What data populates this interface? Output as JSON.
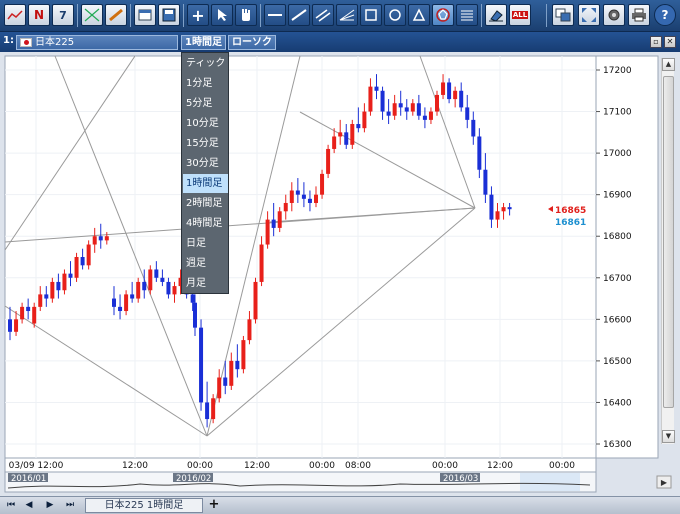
{
  "app": {
    "accent": "#1f4a85"
  },
  "toolbar": {
    "news_letter": "N",
    "calendar_day": "7",
    "all_label": "ALL"
  },
  "symbol": {
    "index": "1:",
    "name": "日本225",
    "timeframe": "1時間足",
    "chart_style": "ローソク"
  },
  "dropdown": {
    "items": [
      "ティック",
      "1分足",
      "5分足",
      "10分足",
      "15分足",
      "30分足",
      "1時間足",
      "2時間足",
      "4時間足",
      "日足",
      "週足",
      "月足"
    ],
    "selected": "1時間足"
  },
  "price_axis": {
    "ticks": [
      "17200",
      "17100",
      "17000",
      "16900",
      "16800",
      "16700",
      "16600",
      "16500",
      "16400",
      "16300"
    ],
    "ask_label": "16865",
    "bid_label": "16861",
    "ask_color": "#e0201c",
    "bid_color": "#1e90d0"
  },
  "time_axis": {
    "labels": [
      "03/09 12:00",
      "12:00",
      "00:00",
      "12:00",
      "00:00",
      "08:00",
      "00:00",
      "12:00",
      "00:00"
    ]
  },
  "navigator": {
    "labels": [
      "2016/01",
      "2016/02",
      "2016/03"
    ]
  },
  "bottom": {
    "tab_label": "日本225 1時間足",
    "add_label": "+"
  },
  "chart_data": {
    "type": "candlestick",
    "ylim": [
      16280,
      17240
    ],
    "up_color": "#e8201a",
    "down_color": "#1a2fd6",
    "candles": [
      {
        "o": 16600,
        "h": 16630,
        "l": 16550,
        "c": 16570
      },
      {
        "o": 16570,
        "h": 16620,
        "l": 16560,
        "c": 16600
      },
      {
        "o": 16600,
        "h": 16640,
        "l": 16590,
        "c": 16630
      },
      {
        "o": 16630,
        "h": 16650,
        "l": 16600,
        "c": 16620
      },
      {
        "o": 16590,
        "h": 16640,
        "l": 16580,
        "c": 16630
      },
      {
        "o": 16630,
        "h": 16680,
        "l": 16620,
        "c": 16660
      },
      {
        "o": 16660,
        "h": 16680,
        "l": 16630,
        "c": 16650
      },
      {
        "o": 16650,
        "h": 16700,
        "l": 16640,
        "c": 16690
      },
      {
        "o": 16690,
        "h": 16710,
        "l": 16650,
        "c": 16670
      },
      {
        "o": 16670,
        "h": 16720,
        "l": 16660,
        "c": 16710
      },
      {
        "o": 16710,
        "h": 16740,
        "l": 16680,
        "c": 16700
      },
      {
        "o": 16700,
        "h": 16760,
        "l": 16690,
        "c": 16750
      },
      {
        "o": 16750,
        "h": 16770,
        "l": 16720,
        "c": 16730
      },
      {
        "o": 16730,
        "h": 16790,
        "l": 16720,
        "c": 16780
      },
      {
        "o": 16780,
        "h": 16820,
        "l": 16760,
        "c": 16800
      },
      {
        "o": 16800,
        "h": 16830,
        "l": 16770,
        "c": 16790
      },
      {
        "o": 16790,
        "h": 16810,
        "l": 16780,
        "c": 16800
      },
      {
        "o": 16650,
        "h": 16680,
        "l": 16610,
        "c": 16630
      },
      {
        "o": 16630,
        "h": 16660,
        "l": 16600,
        "c": 16620
      },
      {
        "o": 16620,
        "h": 16670,
        "l": 16610,
        "c": 16660
      },
      {
        "o": 16660,
        "h": 16690,
        "l": 16640,
        "c": 16650
      },
      {
        "o": 16650,
        "h": 16700,
        "l": 16640,
        "c": 16690
      },
      {
        "o": 16690,
        "h": 16720,
        "l": 16650,
        "c": 16670
      },
      {
        "o": 16670,
        "h": 16730,
        "l": 16660,
        "c": 16720
      },
      {
        "o": 16720,
        "h": 16740,
        "l": 16690,
        "c": 16700
      },
      {
        "o": 16700,
        "h": 16720,
        "l": 16680,
        "c": 16690
      },
      {
        "o": 16690,
        "h": 16700,
        "l": 16650,
        "c": 16660
      },
      {
        "o": 16660,
        "h": 16690,
        "l": 16640,
        "c": 16680
      },
      {
        "o": 16680,
        "h": 16720,
        "l": 16660,
        "c": 16700
      },
      {
        "o": 16700,
        "h": 16720,
        "l": 16650,
        "c": 16660
      },
      {
        "o": 16660,
        "h": 16680,
        "l": 16620,
        "c": 16640
      },
      {
        "o": 16640,
        "h": 16660,
        "l": 16560,
        "c": 16580
      },
      {
        "o": 16580,
        "h": 16600,
        "l": 16380,
        "c": 16400
      },
      {
        "o": 16400,
        "h": 16450,
        "l": 16340,
        "c": 16360
      },
      {
        "o": 16360,
        "h": 16420,
        "l": 16350,
        "c": 16410
      },
      {
        "o": 16410,
        "h": 16480,
        "l": 16400,
        "c": 16460
      },
      {
        "o": 16460,
        "h": 16500,
        "l": 16420,
        "c": 16440
      },
      {
        "o": 16440,
        "h": 16520,
        "l": 16430,
        "c": 16500
      },
      {
        "o": 16500,
        "h": 16540,
        "l": 16460,
        "c": 16480
      },
      {
        "o": 16480,
        "h": 16560,
        "l": 16470,
        "c": 16550
      },
      {
        "o": 16550,
        "h": 16620,
        "l": 16540,
        "c": 16600
      },
      {
        "o": 16600,
        "h": 16700,
        "l": 16590,
        "c": 16690
      },
      {
        "o": 16690,
        "h": 16800,
        "l": 16680,
        "c": 16780
      },
      {
        "o": 16780,
        "h": 16860,
        "l": 16770,
        "c": 16840
      },
      {
        "o": 16840,
        "h": 16880,
        "l": 16800,
        "c": 16820
      },
      {
        "o": 16820,
        "h": 16870,
        "l": 16810,
        "c": 16860
      },
      {
        "o": 16860,
        "h": 16900,
        "l": 16840,
        "c": 16880
      },
      {
        "o": 16880,
        "h": 16930,
        "l": 16860,
        "c": 16910
      },
      {
        "o": 16910,
        "h": 16940,
        "l": 16880,
        "c": 16900
      },
      {
        "o": 16900,
        "h": 16930,
        "l": 16870,
        "c": 16890
      },
      {
        "o": 16890,
        "h": 16910,
        "l": 16860,
        "c": 16880
      },
      {
        "o": 16880,
        "h": 16920,
        "l": 16870,
        "c": 16900
      },
      {
        "o": 16900,
        "h": 16960,
        "l": 16890,
        "c": 16950
      },
      {
        "o": 16950,
        "h": 17020,
        "l": 16940,
        "c": 17010
      },
      {
        "o": 17010,
        "h": 17060,
        "l": 17000,
        "c": 17040
      },
      {
        "o": 17040,
        "h": 17080,
        "l": 17020,
        "c": 17050
      },
      {
        "o": 17050,
        "h": 17070,
        "l": 17010,
        "c": 17020
      },
      {
        "o": 17020,
        "h": 17080,
        "l": 17010,
        "c": 17070
      },
      {
        "o": 17070,
        "h": 17110,
        "l": 17050,
        "c": 17060
      },
      {
        "o": 17060,
        "h": 17120,
        "l": 17050,
        "c": 17100
      },
      {
        "o": 17100,
        "h": 17180,
        "l": 17090,
        "c": 17160
      },
      {
        "o": 17160,
        "h": 17190,
        "l": 17130,
        "c": 17150
      },
      {
        "o": 17150,
        "h": 17160,
        "l": 17080,
        "c": 17100
      },
      {
        "o": 17100,
        "h": 17130,
        "l": 17070,
        "c": 17090
      },
      {
        "o": 17090,
        "h": 17140,
        "l": 17080,
        "c": 17120
      },
      {
        "o": 17120,
        "h": 17150,
        "l": 17090,
        "c": 17110
      },
      {
        "o": 17110,
        "h": 17130,
        "l": 17080,
        "c": 17100
      },
      {
        "o": 17100,
        "h": 17130,
        "l": 17090,
        "c": 17120
      },
      {
        "o": 17120,
        "h": 17140,
        "l": 17080,
        "c": 17090
      },
      {
        "o": 17090,
        "h": 17110,
        "l": 17060,
        "c": 17080
      },
      {
        "o": 17080,
        "h": 17110,
        "l": 17070,
        "c": 17100
      },
      {
        "o": 17100,
        "h": 17150,
        "l": 17090,
        "c": 17140
      },
      {
        "o": 17140,
        "h": 17190,
        "l": 17130,
        "c": 17170
      },
      {
        "o": 17170,
        "h": 17180,
        "l": 17120,
        "c": 17130
      },
      {
        "o": 17130,
        "h": 17160,
        "l": 17110,
        "c": 17150
      },
      {
        "o": 17150,
        "h": 17170,
        "l": 17100,
        "c": 17110
      },
      {
        "o": 17110,
        "h": 17140,
        "l": 17060,
        "c": 17080
      },
      {
        "o": 17080,
        "h": 17100,
        "l": 17020,
        "c": 17040
      },
      {
        "o": 17040,
        "h": 17060,
        "l": 16940,
        "c": 16960
      },
      {
        "o": 16960,
        "h": 17000,
        "l": 16880,
        "c": 16900
      },
      {
        "o": 16900,
        "h": 16920,
        "l": 16820,
        "c": 16840
      },
      {
        "o": 16840,
        "h": 16880,
        "l": 16820,
        "c": 16860
      },
      {
        "o": 16860,
        "h": 16880,
        "l": 16840,
        "c": 16870
      },
      {
        "o": 16870,
        "h": 16880,
        "l": 16850,
        "c": 16865
      }
    ]
  }
}
